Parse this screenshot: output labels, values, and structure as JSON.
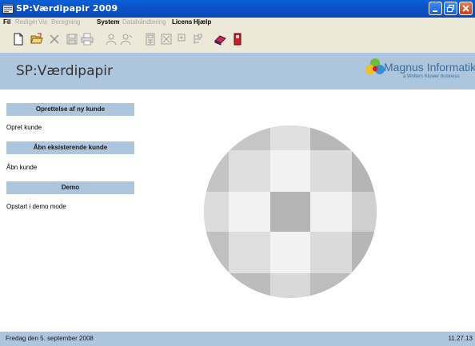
{
  "window": {
    "title": "SP:Værdipapir 2009"
  },
  "menubar": {
    "items": [
      {
        "label": "Fil",
        "enabled": true
      },
      {
        "label": "Redigér",
        "enabled": false
      },
      {
        "label": "Vis",
        "enabled": false
      },
      {
        "label": "Beregning",
        "enabled": false
      },
      {
        "label": "System",
        "enabled": true
      },
      {
        "label": "Datahåndtering",
        "enabled": false
      },
      {
        "label": "Licens",
        "enabled": true
      },
      {
        "label": "Hjælp",
        "enabled": true
      }
    ]
  },
  "toolbar": {
    "icons": [
      "new-document-icon",
      "open-folder-icon",
      "delete-icon",
      "save-icon",
      "print-icon",
      "user-icon",
      "user-edit-icon",
      "calculator-icon",
      "export-icon",
      "import-icon",
      "report-icon",
      "eraser-icon",
      "exit-door-icon"
    ]
  },
  "header": {
    "page_title": "SP:Værdipapir",
    "logo_name": "Magnus Informatik",
    "logo_sub": "a Wolters Kluwer business"
  },
  "sidebar": {
    "sections": [
      {
        "title": "Oprettelse af ny kunde",
        "link": "Opret kunde"
      },
      {
        "title": "Åbn eksisterende kunde",
        "link": "Åbn kunde"
      },
      {
        "title": "Demo",
        "link": "Opstart i demo mode"
      }
    ]
  },
  "statusbar": {
    "date": "Fredag den 5. september 2008",
    "time": "11.27.13"
  },
  "colors": {
    "titlebar": "#0a54c8",
    "chrome": "#ece9d8",
    "accent": "#aec6dd"
  }
}
